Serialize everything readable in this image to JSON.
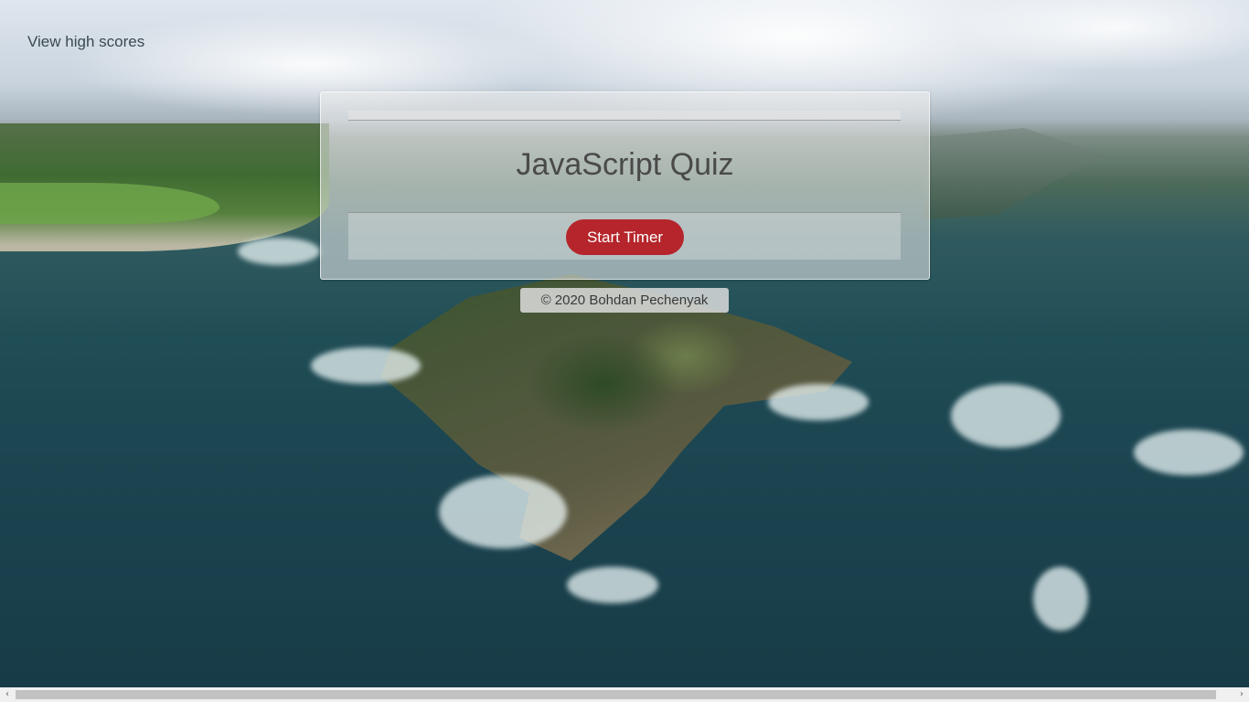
{
  "nav": {
    "high_scores_label": "View high scores"
  },
  "quiz": {
    "title": "JavaScript Quiz",
    "start_button_label": "Start Timer"
  },
  "footer": {
    "copyright": "© 2020 Bohdan Pechenyak"
  },
  "scrollbar": {
    "left_arrow": "‹",
    "right_arrow": "›"
  },
  "colors": {
    "accent": "#b5252b",
    "card_background": "rgba(240,240,240,0.55)",
    "text": "#4a4a4a"
  }
}
